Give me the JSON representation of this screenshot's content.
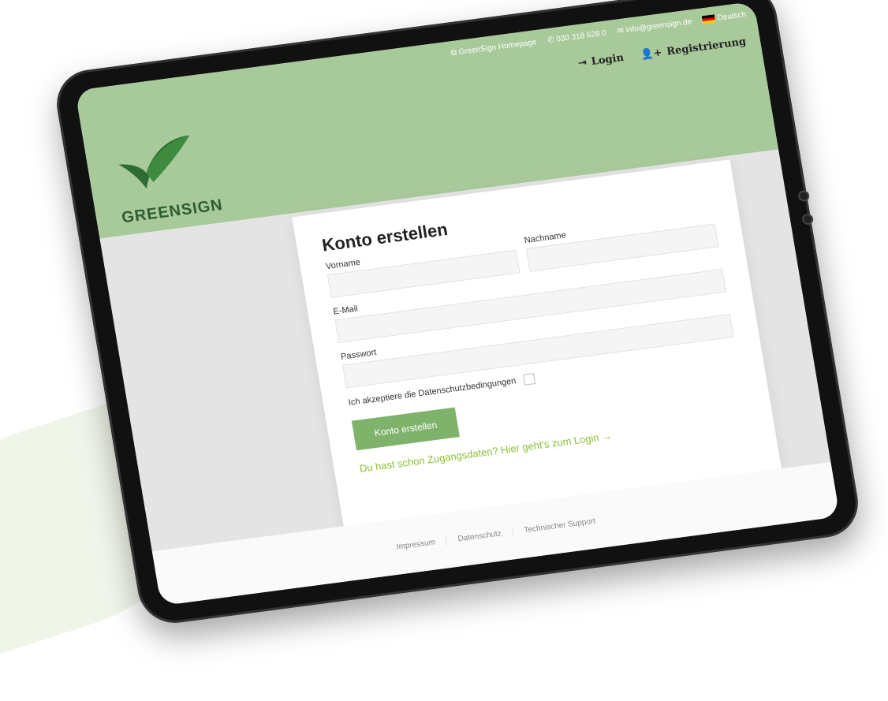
{
  "brand": {
    "name": "GREENSIGN",
    "colors": {
      "header": "#a8c99a",
      "button": "#7fb36b",
      "link": "#8cbf33",
      "logo_dark": "#2f5b32"
    }
  },
  "topbar": {
    "homepage": "GreenSign Homepage",
    "phone": "030 318 628 0",
    "email": "info@greensign.de",
    "language": "Deutsch"
  },
  "nav": {
    "login": "Login",
    "register": "Registrierung"
  },
  "form": {
    "title": "Konto erstellen",
    "first_name_label": "Vorname",
    "last_name_label": "Nachname",
    "email_label": "E-Mail",
    "password_label": "Passwort",
    "consent_label": "Ich akzeptiere die Datenschutzbedingungen",
    "submit_label": "Konto erstellen",
    "login_link": "Du hast schon Zugangsdaten? Hier geht's zum Login →"
  },
  "footer": {
    "links": [
      "Impressum",
      "Datenschutz",
      "Technischer Support"
    ]
  }
}
